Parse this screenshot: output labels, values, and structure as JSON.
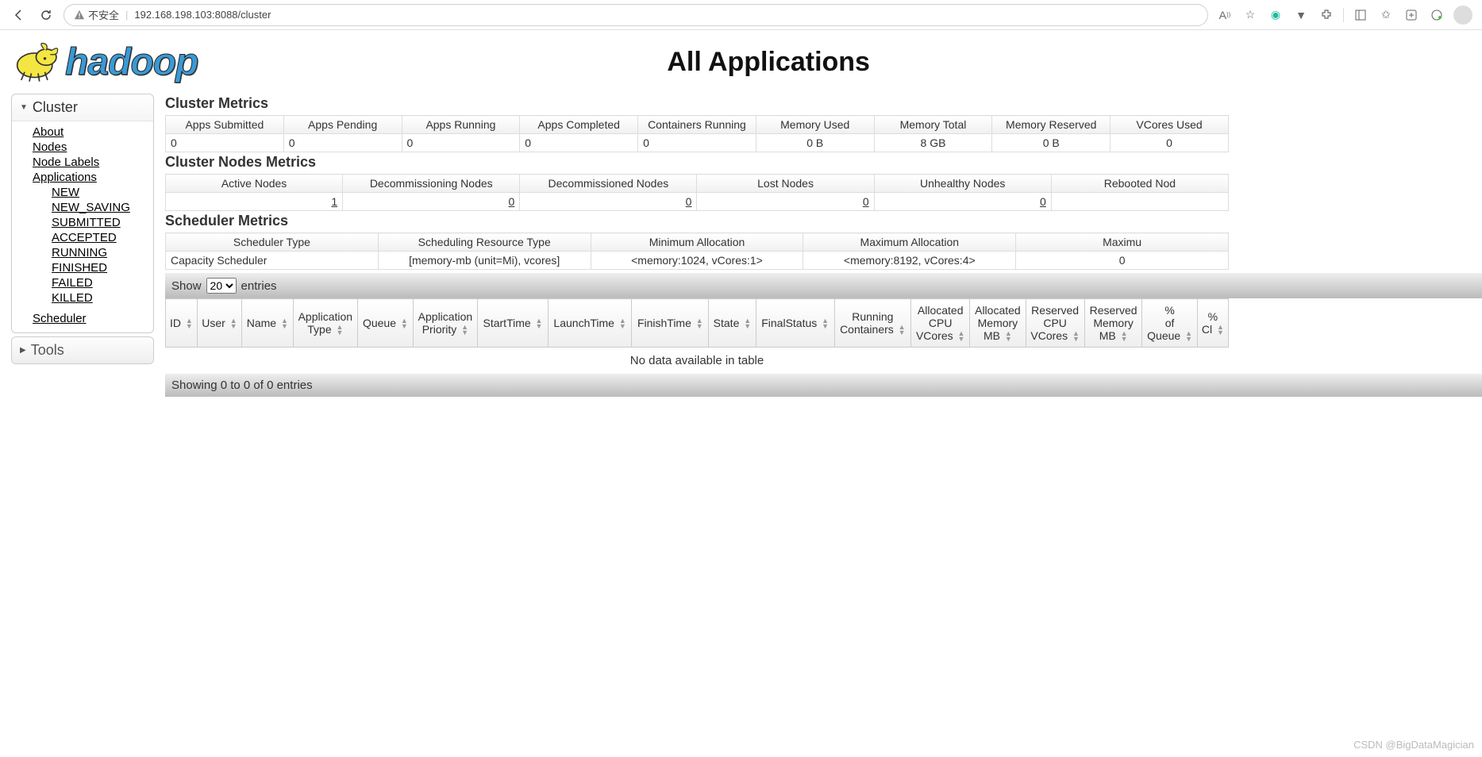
{
  "browser": {
    "insecure_label": "不安全",
    "url": "192.168.198.103:8088/cluster"
  },
  "header": {
    "logo_text": "hadoop",
    "title": "All Applications"
  },
  "sidebar": {
    "cluster": {
      "title": "Cluster",
      "items": [
        {
          "label": "About"
        },
        {
          "label": "Nodes"
        },
        {
          "label": "Node Labels"
        },
        {
          "label": "Applications"
        }
      ],
      "app_states": [
        {
          "label": "NEW"
        },
        {
          "label": "NEW_SAVING"
        },
        {
          "label": "SUBMITTED"
        },
        {
          "label": "ACCEPTED"
        },
        {
          "label": "RUNNING"
        },
        {
          "label": "FINISHED"
        },
        {
          "label": "FAILED"
        },
        {
          "label": "KILLED"
        }
      ],
      "scheduler_label": "Scheduler"
    },
    "tools": {
      "title": "Tools"
    }
  },
  "cluster_metrics": {
    "title": "Cluster Metrics",
    "headers": [
      "Apps Submitted",
      "Apps Pending",
      "Apps Running",
      "Apps Completed",
      "Containers Running",
      "Memory Used",
      "Memory Total",
      "Memory Reserved",
      "VCores Used"
    ],
    "row": [
      "0",
      "0",
      "0",
      "0",
      "0",
      "0 B",
      "8 GB",
      "0 B",
      "0"
    ]
  },
  "nodes_metrics": {
    "title": "Cluster Nodes Metrics",
    "headers": [
      "Active Nodes",
      "Decommissioning Nodes",
      "Decommissioned Nodes",
      "Lost Nodes",
      "Unhealthy Nodes",
      "Rebooted Nod"
    ],
    "row": [
      "1",
      "0",
      "0",
      "0",
      "0",
      ""
    ]
  },
  "scheduler_metrics": {
    "title": "Scheduler Metrics",
    "headers": [
      "Scheduler Type",
      "Scheduling Resource Type",
      "Minimum Allocation",
      "Maximum Allocation",
      "Maximu"
    ],
    "row": [
      "Capacity Scheduler",
      "[memory-mb (unit=Mi), vcores]",
      "<memory:1024, vCores:1>",
      "<memory:8192, vCores:4>",
      "0"
    ]
  },
  "datatable": {
    "show_prefix": "Show",
    "show_value": "20",
    "show_suffix": "entries",
    "columns": [
      "ID",
      "User",
      "Name",
      "Application Type",
      "Queue",
      "Application Priority",
      "StartTime",
      "LaunchTime",
      "FinishTime",
      "State",
      "FinalStatus",
      "Running Containers",
      "Allocated CPU VCores",
      "Allocated Memory MB",
      "Reserved CPU VCores",
      "Reserved Memory MB",
      "% of Queue",
      "% Cl"
    ],
    "empty": "No data available in table",
    "info": "Showing 0 to 0 of 0 entries"
  },
  "watermark": "CSDN @BigDataMagician"
}
